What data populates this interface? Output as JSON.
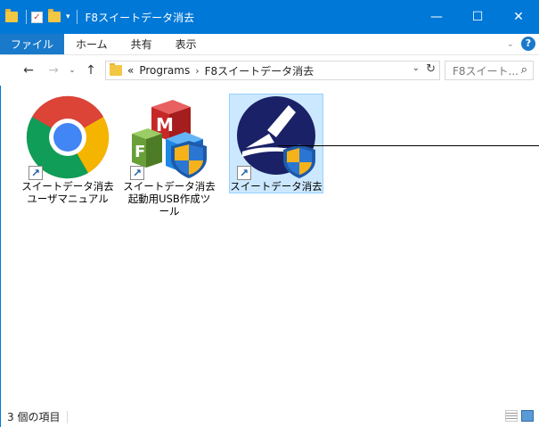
{
  "window": {
    "title": "F8スイートデータ消去",
    "controls": {
      "minimize": "—",
      "maximize": "☐",
      "close": "✕"
    }
  },
  "ribbon": {
    "tabs": [
      {
        "label": "ファイル",
        "active": true
      },
      {
        "label": "ホーム",
        "active": false
      },
      {
        "label": "共有",
        "active": false
      },
      {
        "label": "表示",
        "active": false
      }
    ],
    "help_label": "?"
  },
  "navigation": {
    "back": "←",
    "forward": "→",
    "recent": "⌄",
    "up": "↑",
    "breadcrumb": {
      "overflow": "«",
      "parts": [
        "Programs",
        "F8スイートデータ消去"
      ],
      "separator": "›"
    },
    "refresh": "↻",
    "search_placeholder": "F8スイート...",
    "search_icon": "⌕"
  },
  "items": [
    {
      "label": "スイートデータ消去ユーザマニュアル",
      "icon": "chrome-icon",
      "shortcut": true,
      "selected": false
    },
    {
      "label": "スイートデータ消去起動用USB作成ツール",
      "icon": "mf-boxes-shield-icon",
      "shortcut": true,
      "selected": false
    },
    {
      "label": "スイートデータ消去",
      "icon": "eraser-shield-icon",
      "shortcut": true,
      "selected": true
    }
  ],
  "status": {
    "count_text": "3 個の項目"
  },
  "colors": {
    "titlebar": "#0078d7",
    "active_tab": "#1979ca",
    "selection": "#cce8ff"
  }
}
